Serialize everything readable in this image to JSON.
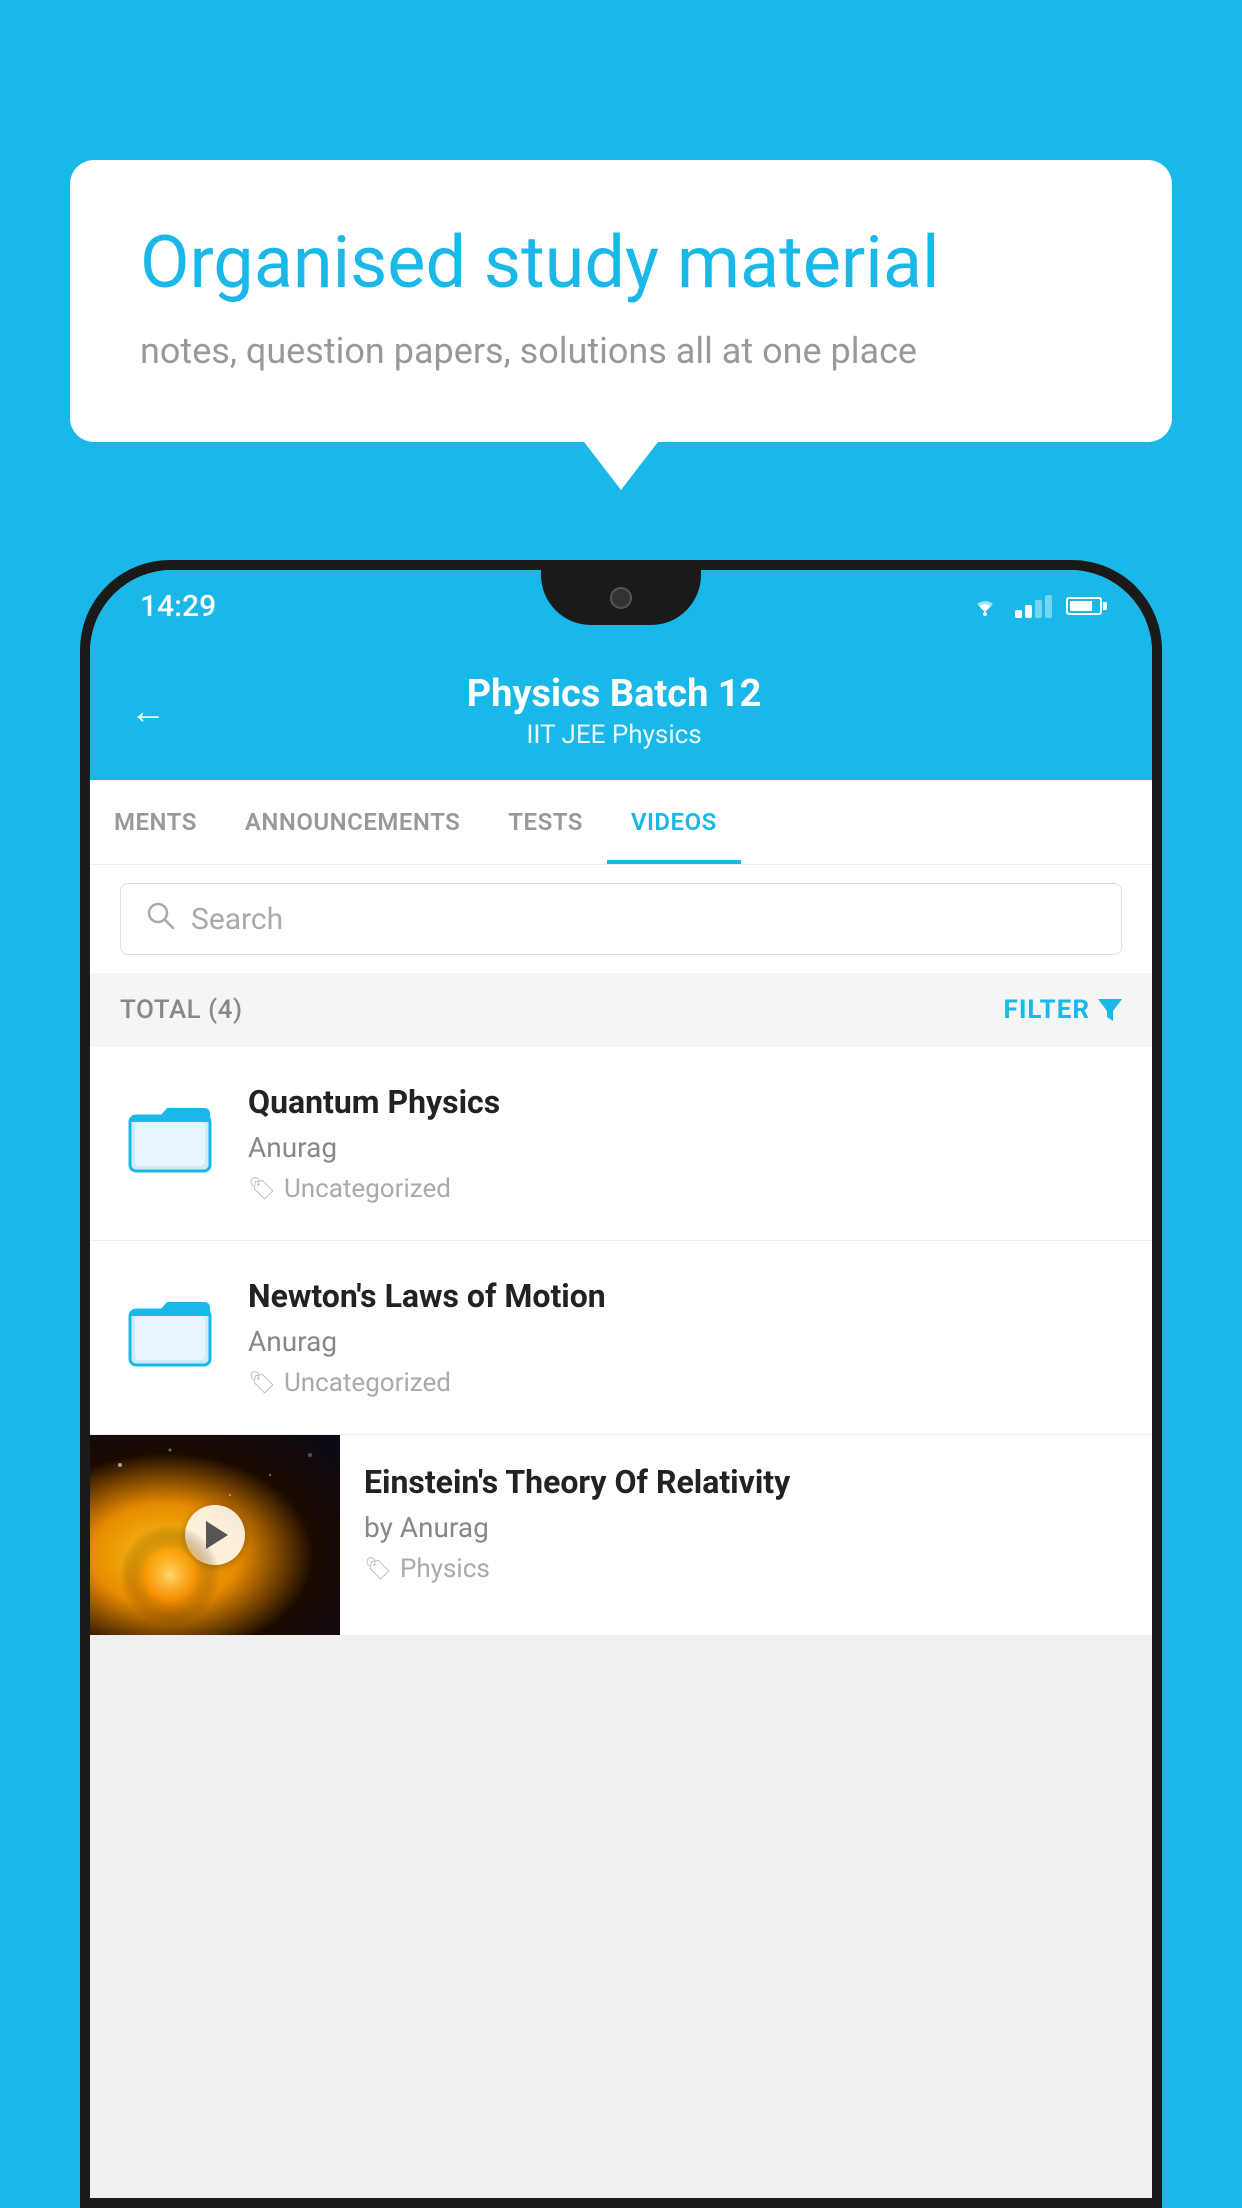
{
  "background_color": "#1ab8e8",
  "bubble": {
    "title": "Organised study material",
    "subtitle": "notes, question papers, solutions all at one place"
  },
  "status_bar": {
    "time": "14:29"
  },
  "header": {
    "title": "Physics Batch 12",
    "subtitle": "IIT JEE   Physics",
    "back_label": "←"
  },
  "tabs": [
    {
      "label": "MENTS",
      "active": false
    },
    {
      "label": "ANNOUNCEMENTS",
      "active": false
    },
    {
      "label": "TESTS",
      "active": false
    },
    {
      "label": "VIDEOS",
      "active": true
    }
  ],
  "search": {
    "placeholder": "Search"
  },
  "filter": {
    "total": "TOTAL (4)",
    "button": "FILTER"
  },
  "videos": [
    {
      "title": "Quantum Physics",
      "author": "Anurag",
      "tag": "Uncategorized",
      "has_thumb": false
    },
    {
      "title": "Newton's Laws of Motion",
      "author": "Anurag",
      "tag": "Uncategorized",
      "has_thumb": false
    },
    {
      "title": "Einstein's Theory Of Relativity",
      "author": "by Anurag",
      "tag": "Physics",
      "has_thumb": true
    }
  ]
}
